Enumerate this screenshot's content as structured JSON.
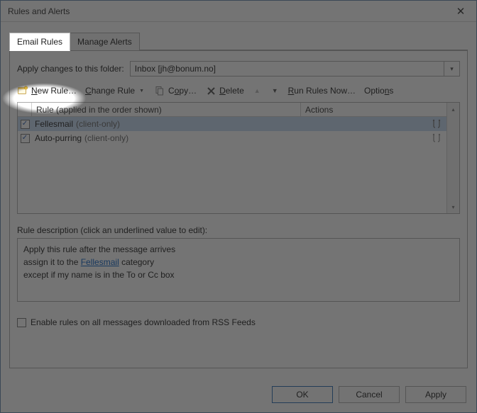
{
  "window": {
    "title": "Rules and Alerts"
  },
  "tabs": {
    "email_rules": "Email Rules",
    "manage_alerts": "Manage Alerts"
  },
  "folder": {
    "label": "Apply changes to this folder:",
    "value": "Inbox [jh@bonum.no]"
  },
  "toolbar": {
    "new_rule": "New Rule…",
    "change_rule": "Change Rule",
    "copy": "Copy…",
    "delete": "Delete",
    "run_now": "Run Rules Now…",
    "options": "Options"
  },
  "grid": {
    "col_rule": "Rule (applied in the order shown)",
    "col_actions": "Actions",
    "rows": [
      {
        "name": "Fellesmail",
        "suffix": "(client-only)"
      },
      {
        "name": "Auto-purring",
        "suffix": "(client-only)"
      }
    ]
  },
  "description": {
    "label": "Rule description (click an underlined value to edit):",
    "line1": "Apply this rule after the message arrives",
    "line2a": "assign it to the ",
    "line2_link": "Fellesmail",
    "line2b": " category",
    "line3": "except if my name is in the To or Cc box"
  },
  "rss": {
    "label": "Enable rules on all messages downloaded from RSS Feeds"
  },
  "buttons": {
    "ok": "OK",
    "cancel": "Cancel",
    "apply": "Apply"
  }
}
